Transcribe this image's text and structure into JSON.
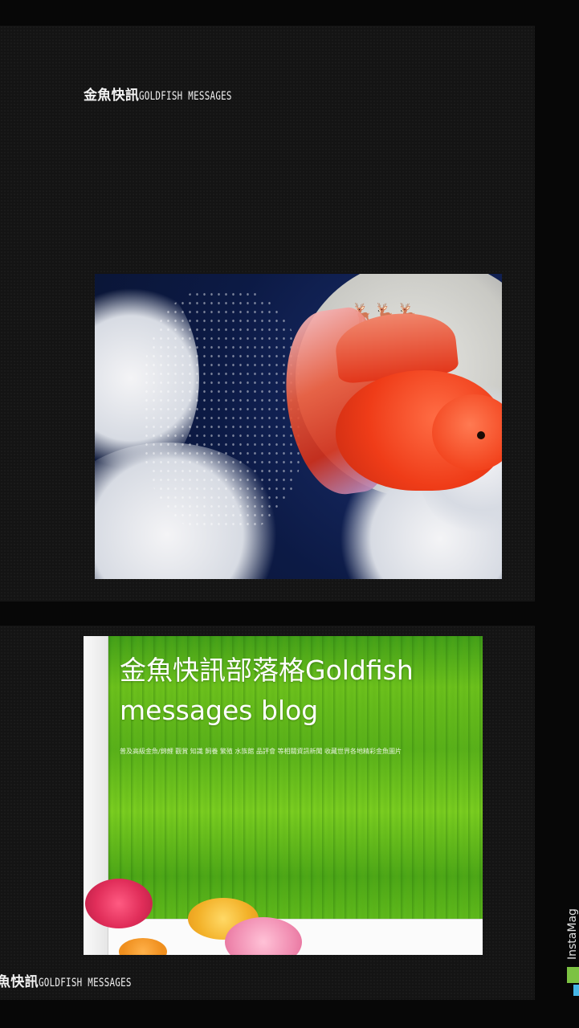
{
  "captions": {
    "top_cjk": "金魚快訊",
    "top_latin": "GOLDFISH MESSAGES",
    "bottom_cjk": "魚快訊",
    "bottom_latin": "GOLDFISH MESSAGES"
  },
  "blog": {
    "title": "金魚快訊部落格Goldfish messages blog",
    "description": "普及高級金魚/錦鯉 觀賞 知識 飼養 繁殖 水族館 品評會 等相關資訊新聞 收藏世界各地精彩金魚圖片"
  },
  "watermark": {
    "text": "InstaMag"
  }
}
